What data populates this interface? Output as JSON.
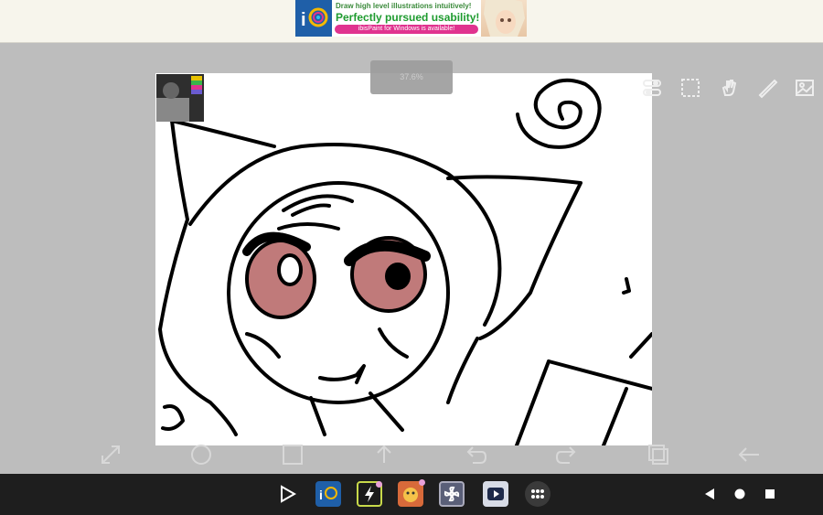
{
  "ad": {
    "line1": "Draw high level illustrations intuitively!",
    "line2": "Perfectly pursued usability!",
    "line3": "ibisPaint for Windows is available!",
    "logo_icon": "ibispaint-logo-icon"
  },
  "status_toast": "37.6%",
  "top_tools": [
    "layers-toggle-icon",
    "selection-icon",
    "hand-icon",
    "ruler-icon",
    "reference-image-icon"
  ],
  "bottom_tools": [
    "transform-icon",
    "brush-circle-icon",
    "color-square-icon",
    "upload-icon",
    "undo-icon",
    "redo-icon",
    "layers-icon",
    "back-arrow-icon"
  ],
  "taskbar": {
    "apps": [
      "play-store-icon",
      "ibispaint-app-icon",
      "app-bolt-icon",
      "game-app-icon",
      "pinwheel-app-icon",
      "video-app-icon",
      "app-drawer-icon"
    ],
    "nav": [
      "back-icon",
      "home-icon",
      "recents-icon"
    ]
  }
}
